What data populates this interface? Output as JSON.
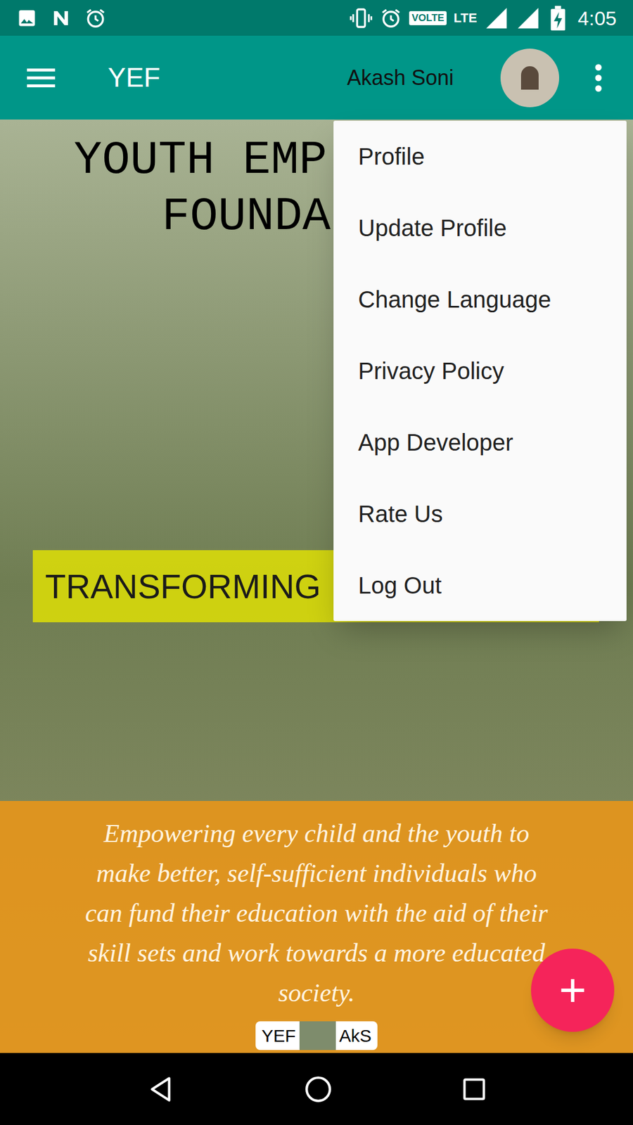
{
  "status_bar": {
    "volte": "VOLTE",
    "network": "LTE",
    "time": "4:05"
  },
  "app_bar": {
    "title": "YEF",
    "user_name": "Akash Soni"
  },
  "banner": {
    "title_lines": [
      "YOUTH EMP",
      "FOUNDA"
    ],
    "tagline": "TRANSFORMING",
    "mission": "Empowering every child and the youth to make better, self-sufficient individuals who can fund their education with the aid of their skill sets and work towards a more educated society."
  },
  "watermark": {
    "left": "YEF",
    "right": "AkS"
  },
  "overflow_menu": {
    "open": true,
    "items": [
      {
        "label": "Profile"
      },
      {
        "label": "Update Profile"
      },
      {
        "label": "Change Language"
      },
      {
        "label": "Privacy Policy"
      },
      {
        "label": "App Developer"
      },
      {
        "label": "Rate Us"
      },
      {
        "label": "Log Out"
      }
    ]
  },
  "fab": {
    "label": "+"
  }
}
